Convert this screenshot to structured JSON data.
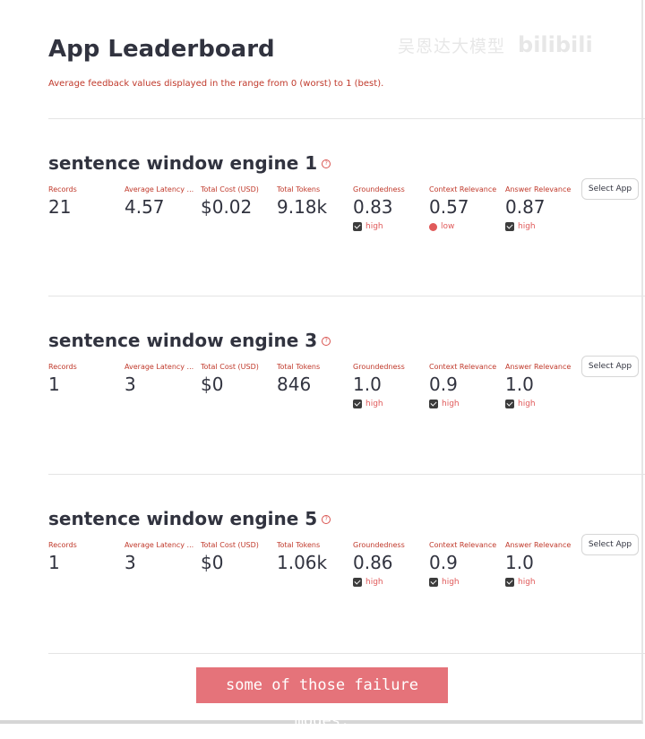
{
  "watermark": {
    "text_cn": "吴恩达大模型",
    "text_bili": "bilibili"
  },
  "header": {
    "title": "App Leaderboard",
    "subtitle": "Average feedback values displayed in the range from 0 (worst) to 1 (best)."
  },
  "metric_labels": {
    "records": "Records",
    "latency": "Average Latency ...",
    "cost": "Total Cost (USD)",
    "tokens": "Total Tokens",
    "groundedness": "Groundedness",
    "context_relevance": "Context Relevance",
    "answer_relevance": "Answer Relevance"
  },
  "select_label": "Select App",
  "apps": [
    {
      "name": "sentence window engine 1",
      "records": "21",
      "latency": "4.57",
      "cost": "$0.02",
      "tokens": "9.18k",
      "groundedness": {
        "value": "0.83",
        "status": "high"
      },
      "context_relevance": {
        "value": "0.57",
        "status": "low"
      },
      "answer_relevance": {
        "value": "0.87",
        "status": "high"
      }
    },
    {
      "name": "sentence window engine 3",
      "records": "1",
      "latency": "3",
      "cost": "$0",
      "tokens": "846",
      "groundedness": {
        "value": "1.0",
        "status": "high"
      },
      "context_relevance": {
        "value": "0.9",
        "status": "high"
      },
      "answer_relevance": {
        "value": "1.0",
        "status": "high"
      }
    },
    {
      "name": "sentence window engine 5",
      "records": "1",
      "latency": "3",
      "cost": "$0",
      "tokens": "1.06k",
      "groundedness": {
        "value": "0.86",
        "status": "high"
      },
      "context_relevance": {
        "value": "0.9",
        "status": "high"
      },
      "answer_relevance": {
        "value": "1.0",
        "status": "high"
      }
    }
  ],
  "caption": "some of those failure modes.",
  "colors": {
    "accent_red": "#c0392b",
    "badge_red": "#e05a5a",
    "caption_bg": "#e5737a",
    "text": "#31333f"
  }
}
